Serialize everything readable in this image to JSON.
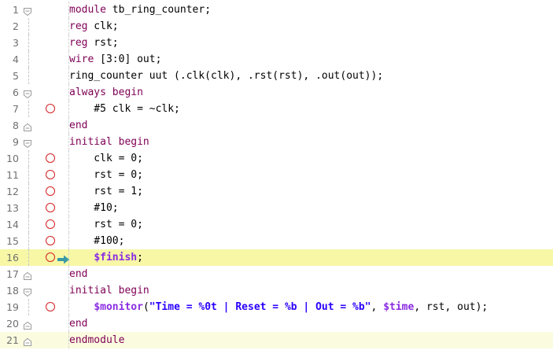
{
  "editor": {
    "lines": [
      {
        "number": "1",
        "fold": "open",
        "breakpoint": false,
        "current": false,
        "cursor": false,
        "tokens": [
          {
            "t": "module",
            "c": "kw"
          },
          {
            "t": " tb_ring_counter;",
            "c": ""
          }
        ]
      },
      {
        "number": "2",
        "fold": "none",
        "breakpoint": false,
        "current": false,
        "cursor": false,
        "tokens": [
          {
            "t": "reg",
            "c": "kw"
          },
          {
            "t": " clk;",
            "c": ""
          }
        ]
      },
      {
        "number": "3",
        "fold": "none",
        "breakpoint": false,
        "current": false,
        "cursor": false,
        "tokens": [
          {
            "t": "reg",
            "c": "kw"
          },
          {
            "t": " rst;",
            "c": ""
          }
        ]
      },
      {
        "number": "4",
        "fold": "none",
        "breakpoint": false,
        "current": false,
        "cursor": false,
        "tokens": [
          {
            "t": "wire",
            "c": "kw"
          },
          {
            "t": " [3:0] out;",
            "c": ""
          }
        ]
      },
      {
        "number": "5",
        "fold": "none",
        "breakpoint": false,
        "current": false,
        "cursor": false,
        "tokens": [
          {
            "t": "ring_counter uut (.clk(clk), .rst(rst), .out(out));",
            "c": ""
          }
        ]
      },
      {
        "number": "6",
        "fold": "open",
        "breakpoint": false,
        "current": false,
        "cursor": false,
        "tokens": [
          {
            "t": "always",
            "c": "kw"
          },
          {
            "t": " ",
            "c": ""
          },
          {
            "t": "begin",
            "c": "kw"
          }
        ]
      },
      {
        "number": "7",
        "fold": "none",
        "breakpoint": true,
        "current": false,
        "cursor": false,
        "tokens": [
          {
            "t": "    #5 clk = ~clk;",
            "c": ""
          }
        ]
      },
      {
        "number": "8",
        "fold": "close",
        "breakpoint": false,
        "current": false,
        "cursor": false,
        "tokens": [
          {
            "t": "end",
            "c": "kw"
          }
        ]
      },
      {
        "number": "9",
        "fold": "open",
        "breakpoint": false,
        "current": false,
        "cursor": false,
        "tokens": [
          {
            "t": "initial",
            "c": "kw"
          },
          {
            "t": " ",
            "c": ""
          },
          {
            "t": "begin",
            "c": "kw"
          }
        ]
      },
      {
        "number": "10",
        "fold": "none",
        "breakpoint": true,
        "current": false,
        "cursor": false,
        "tokens": [
          {
            "t": "    clk = 0;",
            "c": ""
          }
        ]
      },
      {
        "number": "11",
        "fold": "none",
        "breakpoint": true,
        "current": false,
        "cursor": false,
        "tokens": [
          {
            "t": "    rst = 0;",
            "c": ""
          }
        ]
      },
      {
        "number": "12",
        "fold": "none",
        "breakpoint": true,
        "current": false,
        "cursor": false,
        "tokens": [
          {
            "t": "    rst = 1;",
            "c": ""
          }
        ]
      },
      {
        "number": "13",
        "fold": "none",
        "breakpoint": true,
        "current": false,
        "cursor": false,
        "tokens": [
          {
            "t": "    #10;",
            "c": ""
          }
        ]
      },
      {
        "number": "14",
        "fold": "none",
        "breakpoint": true,
        "current": false,
        "cursor": false,
        "tokens": [
          {
            "t": "    rst = 0;",
            "c": ""
          }
        ]
      },
      {
        "number": "15",
        "fold": "none",
        "breakpoint": true,
        "current": false,
        "cursor": false,
        "tokens": [
          {
            "t": "    #100;",
            "c": ""
          }
        ]
      },
      {
        "number": "16",
        "fold": "none",
        "breakpoint": true,
        "current": true,
        "cursor": false,
        "tokens": [
          {
            "t": "    ",
            "c": ""
          },
          {
            "t": "$finish",
            "c": "sys"
          },
          {
            "t": ";",
            "c": ""
          }
        ]
      },
      {
        "number": "17",
        "fold": "close",
        "breakpoint": false,
        "current": false,
        "cursor": false,
        "tokens": [
          {
            "t": "end",
            "c": "kw"
          }
        ]
      },
      {
        "number": "18",
        "fold": "open",
        "breakpoint": false,
        "current": false,
        "cursor": false,
        "tokens": [
          {
            "t": "initial",
            "c": "kw"
          },
          {
            "t": " ",
            "c": ""
          },
          {
            "t": "begin",
            "c": "kw"
          }
        ]
      },
      {
        "number": "19",
        "fold": "none",
        "breakpoint": true,
        "current": false,
        "cursor": false,
        "tokens": [
          {
            "t": "    ",
            "c": ""
          },
          {
            "t": "$monitor",
            "c": "sys"
          },
          {
            "t": "(",
            "c": ""
          },
          {
            "t": "\"Time = %0t | Reset = %b | Out = %b\"",
            "c": "str"
          },
          {
            "t": ", ",
            "c": ""
          },
          {
            "t": "$time",
            "c": "sys"
          },
          {
            "t": ", rst, out);",
            "c": ""
          }
        ]
      },
      {
        "number": "20",
        "fold": "close",
        "breakpoint": false,
        "current": false,
        "cursor": false,
        "tokens": [
          {
            "t": "end",
            "c": "kw"
          }
        ]
      },
      {
        "number": "21",
        "fold": "close",
        "breakpoint": false,
        "current": false,
        "cursor": true,
        "tokens": [
          {
            "t": "endmodule",
            "c": "kw"
          }
        ]
      }
    ]
  },
  "colors": {
    "keyword": "#7f0055",
    "system_task": "#8a2be2",
    "string": "#2a00ff",
    "current_line": "#f7f7a6",
    "cursor_line": "#fbfbe0",
    "breakpoint": "#d42020",
    "execution_arrow": "#3a9aa6"
  },
  "icons": {
    "fold_open": "fold-collapse-icon",
    "fold_close": "fold-end-icon",
    "breakpoint": "breakpoint-icon",
    "current_line": "execution-arrow-icon"
  }
}
